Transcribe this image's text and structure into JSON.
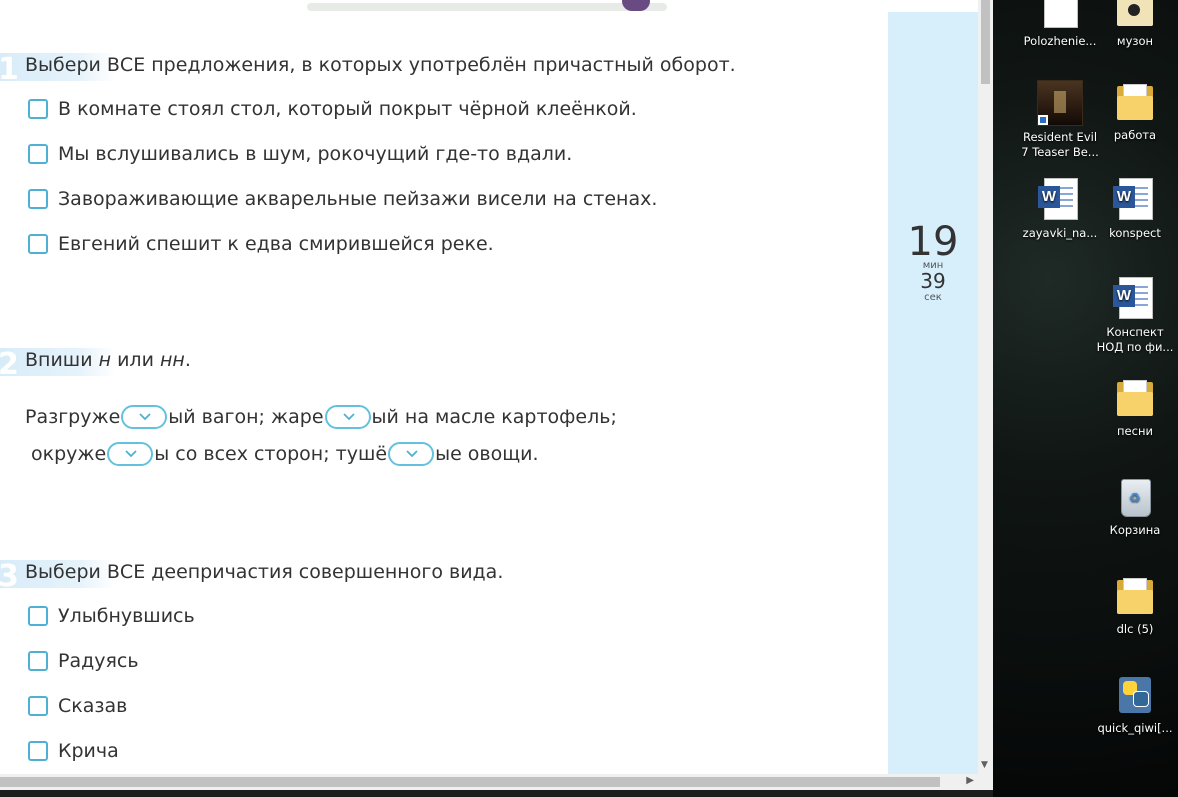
{
  "quiz": {
    "q1": {
      "number": "1",
      "prompt": "Выбери ВСЕ предложения, в которых употреблён причастный оборот.",
      "options": [
        "В комнате стоял стол, который покрыт чёрной клеёнкой.",
        "Мы вслушивались в шум, рокочущий где-то вдали.",
        "Завораживающие акварельные пейзажи висели на стенах.",
        "Евгений спешит к едва смирившейся реке."
      ]
    },
    "q2": {
      "number": "2",
      "prompt_a": "Впиши ",
      "prompt_n1": "н",
      "prompt_b": " или ",
      "prompt_n2": "нн",
      "prompt_c": ".",
      "line1": [
        "Разгруже",
        "ый вагон; жаре",
        "ый на масле картофель;"
      ],
      "line2": [
        "окруже",
        "ы со всех сторон; тушё",
        "ые овощи."
      ]
    },
    "q3": {
      "number": "3",
      "prompt": "Выбери ВСЕ деепричастия совершенного вида.",
      "options": [
        "Улыбнувшись",
        "Радуясь",
        "Сказав",
        "Крича"
      ]
    }
  },
  "timer": {
    "minutes": "19",
    "minutes_unit": "мин",
    "seconds": "39",
    "seconds_unit": "сек"
  },
  "desktop": {
    "icons": [
      {
        "label": "Polozhenie...",
        "icon": "word-doc-icon"
      },
      {
        "label": "музон",
        "icon": "media-folder-icon"
      },
      {
        "label": "Resident Evil 7 Teaser Be...",
        "icon": "game-shortcut-icon"
      },
      {
        "label": "работа",
        "icon": "folder-icon"
      },
      {
        "label": "zayavki_na...",
        "icon": "word-doc-icon"
      },
      {
        "label": "konspect",
        "icon": "word-doc-icon"
      },
      {
        "label": "Конспект НОД по фи...",
        "icon": "word-doc-icon"
      },
      {
        "label": "песни",
        "icon": "folder-icon"
      },
      {
        "label": "Корзина",
        "icon": "recycle-bin-icon"
      },
      {
        "label": "dlc (5)",
        "icon": "folder-icon"
      },
      {
        "label": "quick_qiwi[...",
        "icon": "python-file-icon"
      }
    ]
  },
  "colors": {
    "accent": "#4fb0d6",
    "timer_bg": "#d7eefb",
    "progress_knob": "#6a4a82"
  }
}
